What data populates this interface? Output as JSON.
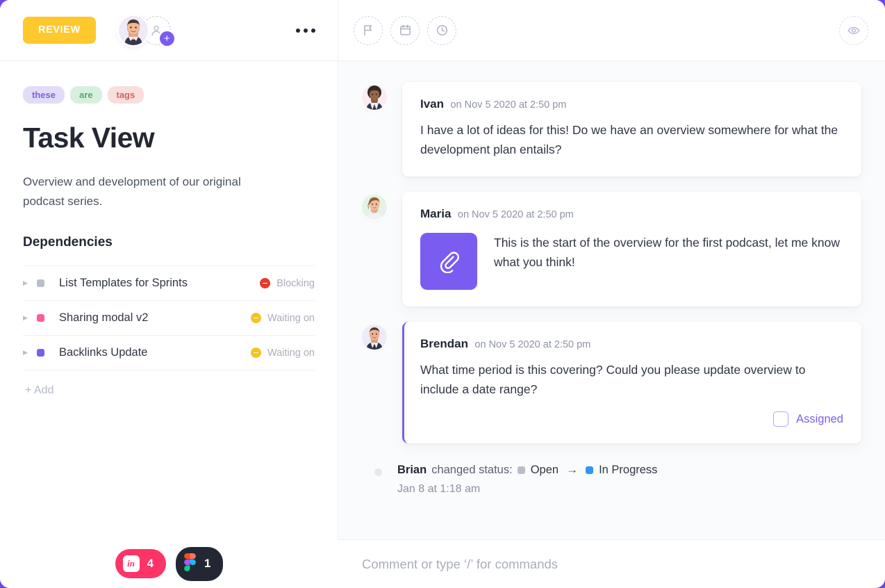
{
  "left_header": {
    "status_button": "REVIEW",
    "avatar_name": "avatar",
    "add_person_label": "+",
    "more_label": "more-options"
  },
  "task": {
    "tags": [
      {
        "label": "these",
        "color": "#7c64d8",
        "bg": "#e2dcf8"
      },
      {
        "label": "are",
        "color": "#56a86c",
        "bg": "#d7f0dd"
      },
      {
        "label": "tags",
        "color": "#d2635e",
        "bg": "#f8dedd"
      }
    ],
    "title": "Task View",
    "description": "Overview and development of our original podcast series.",
    "dependencies_heading": "Dependencies",
    "dependencies": [
      {
        "name": "List Templates for Sprints",
        "square_color": "#b9bec9",
        "status": "Blocking",
        "status_color": "#e8382a"
      },
      {
        "name": "Sharing modal v2",
        "square_color": "#fc5d9b",
        "status": "Waiting on",
        "status_color": "#f5c423"
      },
      {
        "name": "Backlinks Update",
        "square_color": "#7b5cf0",
        "status": "Waiting on",
        "status_color": "#f5c423"
      }
    ],
    "add_label": "+ Add"
  },
  "right_header": {
    "buttons": [
      {
        "name": "flag-icon",
        "title": "Set priority"
      },
      {
        "name": "calendar-icon",
        "title": "Set due date"
      },
      {
        "name": "clock-icon",
        "title": "Track time"
      }
    ],
    "watch_label": "Watch"
  },
  "thread": {
    "comments": [
      {
        "author": "Ivan",
        "time": "on Nov 5 2020 at 2:50 pm",
        "text": "I have a lot of ideas for this! Do we have an overview somewhere for what the development plan entails?",
        "has_attachment": false,
        "highlight": false
      },
      {
        "author": "Maria",
        "time": "on Nov 5 2020 at 2:50 pm",
        "text": "This is the start of the overview for the first podcast, let me know what you think!",
        "has_attachment": true,
        "attachment_icon": "paperclip-icon",
        "highlight": false
      },
      {
        "author": "Brendan",
        "time": "on Nov 5 2020 at 2:50 pm",
        "text": "What time period is this covering? Could you please update overview to include a date range?",
        "has_attachment": false,
        "highlight": true,
        "assigned_label": "Assigned",
        "assigned_checked": false
      }
    ],
    "activity": {
      "actor": "Brian",
      "action": "changed status:",
      "from_status": "Open",
      "from_color": "#b9bec9",
      "to_status": "In Progress",
      "to_color": "#2f97f5",
      "arrow": "→",
      "timestamp": "Jan 8 at 1:18 am"
    }
  },
  "bottom_bar": {
    "integrations": [
      {
        "name": "invision",
        "label": "in",
        "count": "4",
        "bg": "#ff3366"
      },
      {
        "name": "figma",
        "label": "figma-logo",
        "count": "1",
        "bg": "#222733"
      }
    ]
  },
  "composer": {
    "placeholder": "Comment or type ‘/’ for commands",
    "value": ""
  },
  "colors": {
    "accent": "#7b5cf0",
    "review_yellow": "#ffc82c",
    "canvas": "#fafbfc",
    "backdrop": "#6c47e8"
  }
}
